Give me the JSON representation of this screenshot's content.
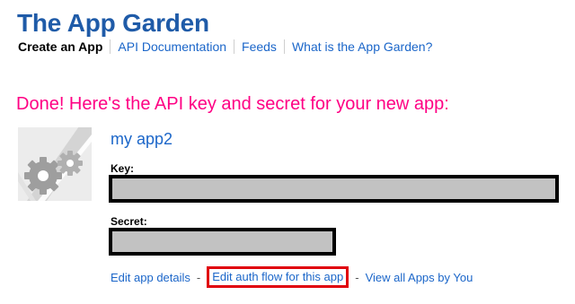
{
  "site": {
    "title": "The App Garden"
  },
  "nav": {
    "items": [
      {
        "label": "Create an App",
        "active": true
      },
      {
        "label": "API Documentation",
        "active": false
      },
      {
        "label": "Feeds",
        "active": false
      },
      {
        "label": "What is the App Garden?",
        "active": false
      }
    ]
  },
  "main": {
    "heading": "Done! Here's the API key and secret for your new app:",
    "heading_color": "#ff0084",
    "app": {
      "name": "my app2",
      "icon": "gear-icon"
    },
    "key_label": "Key:",
    "secret_label": "Secret:",
    "actions": {
      "edit_details": "Edit app details",
      "separator": "-",
      "edit_auth_flow": "Edit auth flow for this app",
      "view_all": "View all Apps by You"
    }
  },
  "colors": {
    "title": "#1f5ba8",
    "link": "#1b66c9",
    "highlight_border": "#e0000b",
    "redaction_fill": "#c2c2c2"
  }
}
